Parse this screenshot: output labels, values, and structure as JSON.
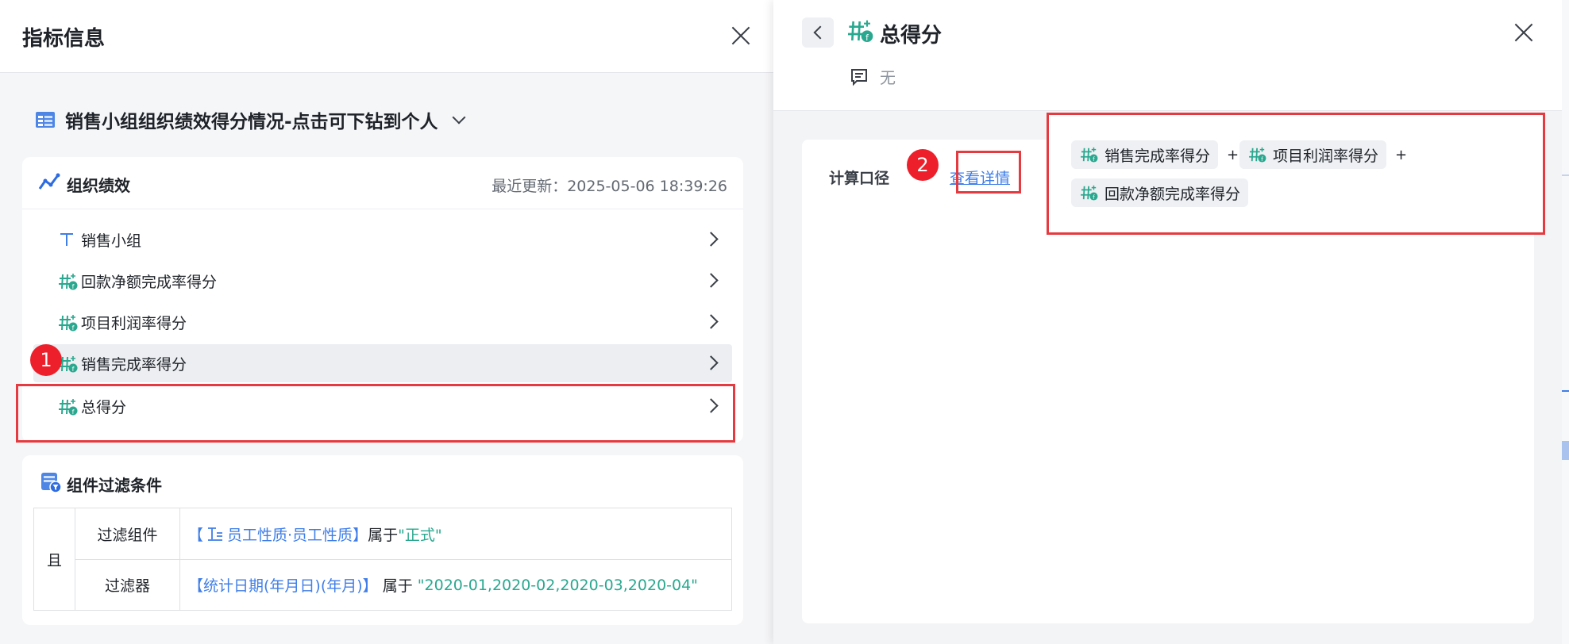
{
  "left": {
    "title": "指标信息",
    "report_title": "销售小组组织绩效得分情况-点击可下钻到个人",
    "perf_card": {
      "title": "组织绩效",
      "updated": "最近更新：2025-05-06 18:39:26",
      "rows": [
        {
          "label": "销售小组",
          "icon": "text-dimension-icon"
        },
        {
          "label": "回款净额完成率得分",
          "icon": "calc-metric-icon"
        },
        {
          "label": "项目利润率得分",
          "icon": "calc-metric-icon"
        },
        {
          "label": "销售完成率得分",
          "icon": "calc-metric-icon"
        },
        {
          "label": "总得分",
          "icon": "calc-metric-icon"
        }
      ]
    },
    "filter_card": {
      "title": "组件过滤条件",
      "and_label": "且",
      "rows": [
        {
          "key": "过滤组件",
          "open": "【",
          "field": "员工性质·员工性质",
          "close": "】",
          "op": "属于",
          "value": "\"正式\""
        },
        {
          "key": "过滤器",
          "open": "【",
          "field": "统计日期(年月日)(年月)",
          "close": "】",
          "op": " 属于 ",
          "value": "\"2020-01,2020-02,2020-03,2020-04\""
        }
      ]
    }
  },
  "right": {
    "title": "总得分",
    "description": "无",
    "calc_label": "计算口径",
    "detail_link": "查看详情",
    "formula": [
      {
        "label": "销售完成率得分"
      },
      {
        "label": "项目利润率得分"
      },
      {
        "label": "回款净额完成率得分"
      }
    ],
    "plus": "+"
  },
  "annotations": {
    "badge1": "1",
    "badge2": "2"
  },
  "colors": {
    "accent_blue": "#3f7ee8",
    "accent_green": "#2aa88f",
    "highlight_red": "#e53a3f"
  }
}
